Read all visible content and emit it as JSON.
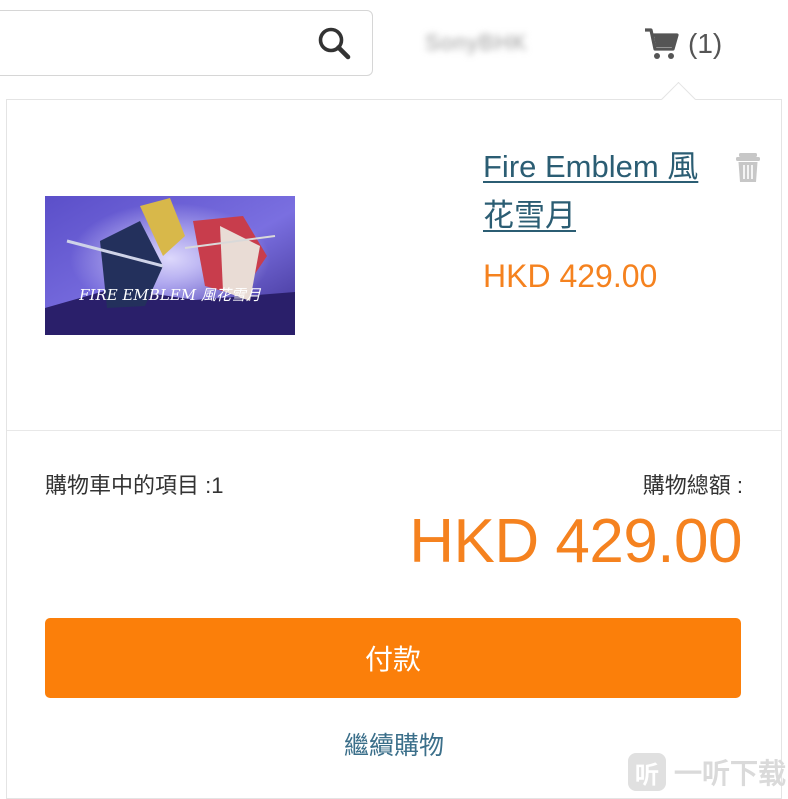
{
  "header": {
    "search_placeholder": "",
    "search_icon": "search-icon",
    "username": "SonyBHK",
    "cart_icon": "shopping-cart-icon",
    "cart_count": "(1)"
  },
  "cart": {
    "items": [
      {
        "title": "Fire Emblem 風花雪月",
        "price": "HKD 429.00",
        "image_caption": "FIRE EMBLEM 風花雪月",
        "delete_icon": "trash-icon"
      }
    ],
    "count_label": "購物車中的項目 :1",
    "total_label": "購物總額 :",
    "total_value": "HKD 429.00",
    "checkout_label": "付款",
    "continue_label": "繼續購物"
  },
  "watermark": {
    "badge": "听",
    "text": "一听下载"
  },
  "colors": {
    "accent": "#fb7f0a",
    "price": "#f5821f",
    "link": "#2b5d73"
  }
}
